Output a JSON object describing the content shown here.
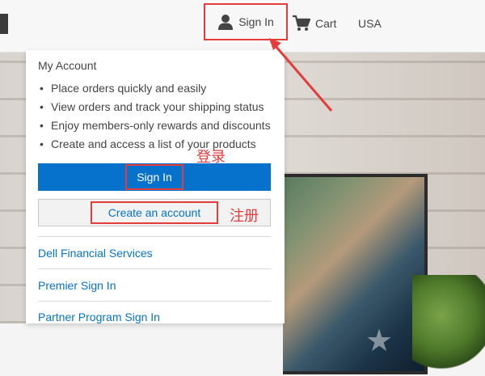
{
  "header": {
    "sign_in_label": "Sign In",
    "cart_label": "Cart",
    "region_label": "USA",
    "icons": {
      "account": "person-icon",
      "cart": "cart-icon"
    }
  },
  "account_panel": {
    "title": "My Account",
    "benefits": [
      "Place orders quickly and easily",
      "View orders and track your shipping status",
      "Enjoy members-only rewards and discounts",
      "Create and access a list of your products"
    ],
    "sign_in_button": "Sign In",
    "create_account_button": "Create an account",
    "links": [
      "Dell Financial Services",
      "Premier Sign In",
      "Partner Program Sign In"
    ]
  },
  "annotations": {
    "signin_note": "登录",
    "register_note": "注册",
    "highlight_color": "#e43b3b"
  },
  "colors": {
    "primary_blue": "#0672cb",
    "topbar_bg": "#f7f7f7"
  }
}
